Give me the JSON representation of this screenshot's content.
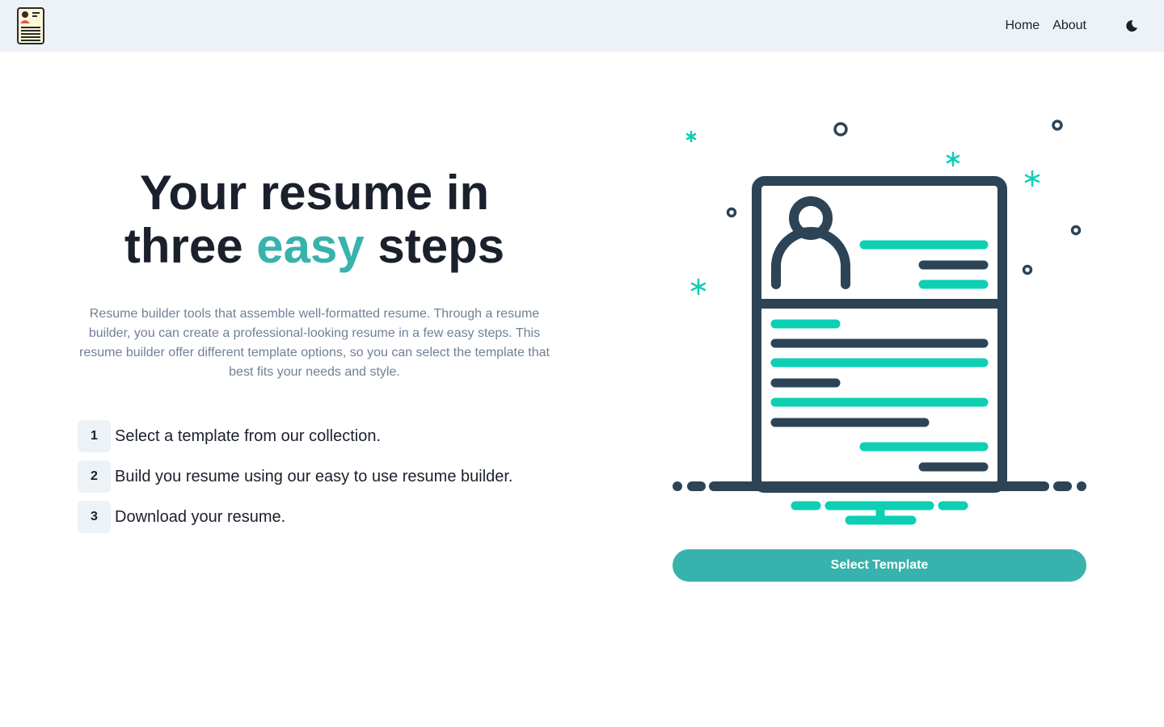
{
  "nav": {
    "logo_icon": "resume-document-icon",
    "links": [
      "Home",
      "About"
    ],
    "theme_toggle_icon": "moon-icon"
  },
  "hero": {
    "headline_line1": "Your resume in",
    "headline_pre": "three ",
    "headline_accent": "easy",
    "headline_post": " steps",
    "description": "Resume builder tools that assemble well-formatted resume. Through a resume builder, you can create a professional-looking resume in a few easy steps. This resume builder offer different template options, so you can select the template that best fits your needs and style.",
    "steps": [
      {
        "number": "1",
        "text": "Select a template from our collection."
      },
      {
        "number": "2",
        "text": "Build you resume using our easy to use resume builder."
      },
      {
        "number": "3",
        "text": "Download your resume."
      }
    ]
  },
  "illustration": {
    "icon": "resume-monitor-illustration-icon"
  },
  "cta": {
    "label": "Select Template"
  },
  "colors": {
    "accent": "#38b2ac",
    "illustration_teal": "#0ccfb3",
    "illustration_dark": "#2d4356",
    "nav_bg": "#edf2f7",
    "text": "#1a202c",
    "muted": "#718096"
  }
}
